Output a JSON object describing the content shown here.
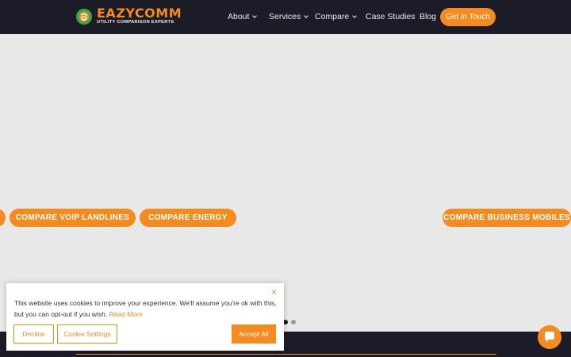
{
  "brand": {
    "name_part1": "EAZY",
    "name_part2": "COMM",
    "tagline": "UTILITY COMPARISON EXPERTS",
    "accent_color": "#f58a1f",
    "header_bg": "#1c1c28"
  },
  "nav": {
    "items": [
      {
        "label": "About",
        "has_dropdown": true
      },
      {
        "label": "Services",
        "has_dropdown": true
      },
      {
        "label": "Compare",
        "has_dropdown": true
      },
      {
        "label": "Case Studies",
        "has_dropdown": false
      },
      {
        "label": "Blog",
        "has_dropdown": false
      }
    ],
    "cta_label": "Get in Touch"
  },
  "hero": {
    "buttons": [
      {
        "label": "COMPARE VOIP LANDLINES"
      },
      {
        "label": "COMPARE ENERGY"
      },
      {
        "label": "COMPARE BUSINESS MOBILES"
      }
    ],
    "carousel": {
      "slides": 2,
      "active_slide": 1
    }
  },
  "cookie_banner": {
    "message": "This website uses cookies to improve your experience. We'll assume you're ok with this, but you can opt-out if you wish.",
    "read_more_label": "Read More",
    "decline_label": "Decline",
    "settings_label": "Cookie Settings",
    "accept_label": "Accept All",
    "close_symbol": "×"
  },
  "icons": {
    "logo": "eazycomm-logo-icon",
    "chat": "chat-bubble-icon",
    "dropdown": "chevron-down-icon"
  }
}
